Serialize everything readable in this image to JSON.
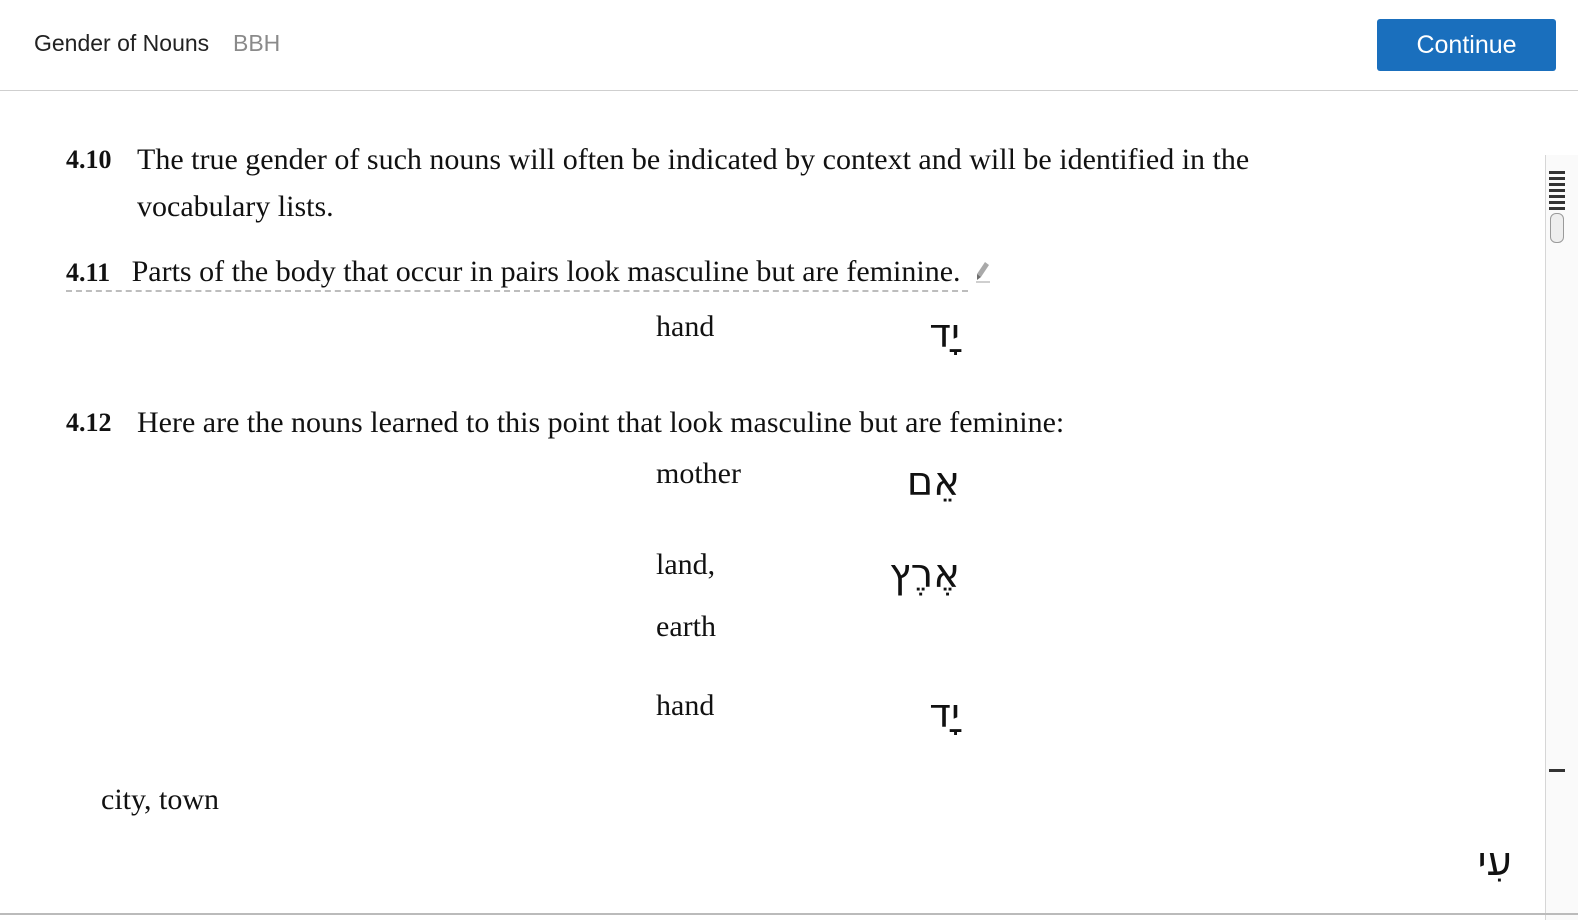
{
  "header": {
    "lesson_title": "Gender of Nouns",
    "course_tag": "BBH",
    "continue_label": "Continue"
  },
  "sections": [
    {
      "number": "4.10",
      "text": "The true gender of such nouns will often be indicated by context and will be identified in the",
      "text_cont": "vocabulary lists."
    },
    {
      "number": "4.11",
      "text": "Parts of the body that occur in pairs look masculine but are feminine."
    },
    {
      "number": "4.12",
      "text": "Here are the nouns learned to this point that look masculine but are feminine:"
    }
  ],
  "vocab_411": [
    {
      "english": "hand",
      "hebrew": "יָד"
    }
  ],
  "vocab_412": [
    {
      "english": "mother",
      "hebrew": "אֵם"
    },
    {
      "english": "land,",
      "english2": "earth",
      "hebrew": "אֶרֶץ"
    },
    {
      "english": "hand",
      "hebrew": "יָד"
    },
    {
      "english": "city, town",
      "hebrew": "עִי"
    }
  ],
  "colors": {
    "accent": "#1a6fbd",
    "muted_text": "#8a8a8a"
  },
  "icons": [
    "pencil-icon"
  ]
}
